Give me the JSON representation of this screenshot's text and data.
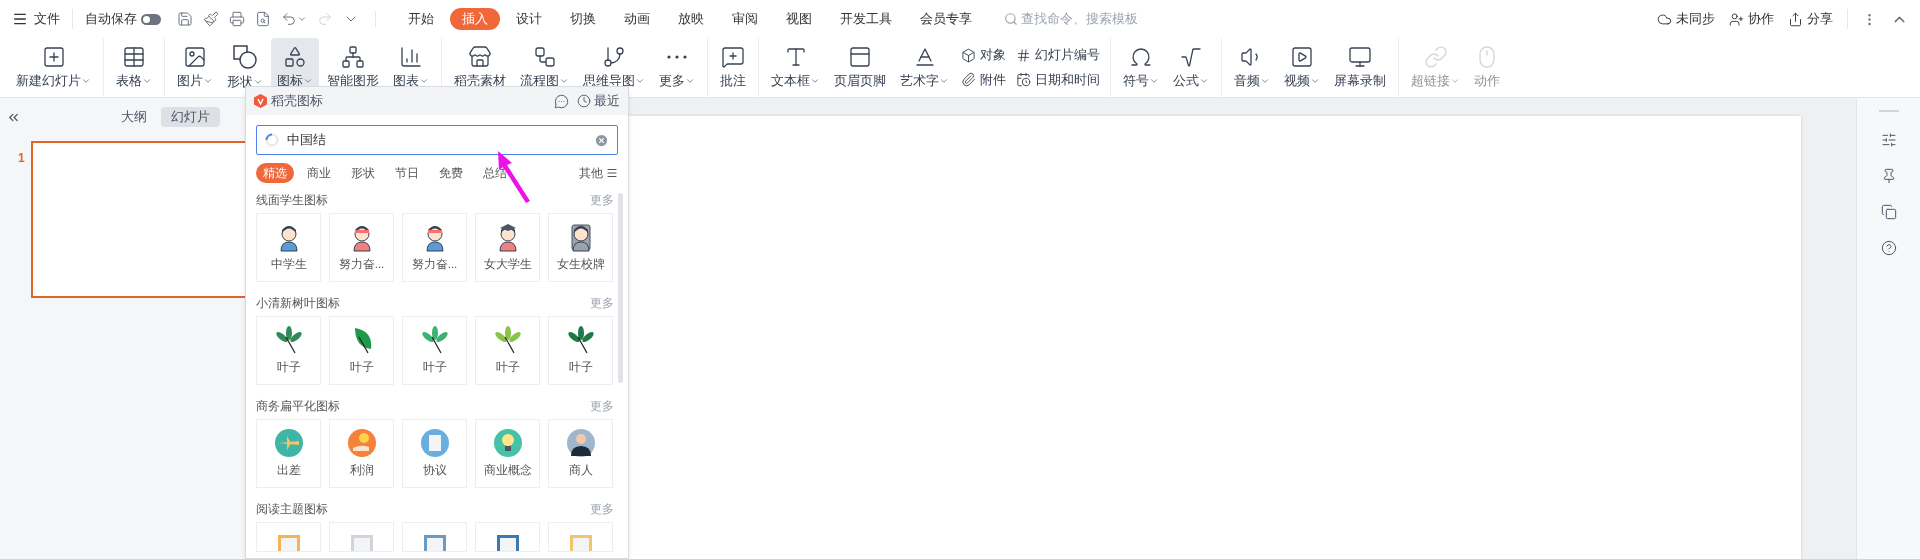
{
  "menu_bar": {
    "file_menu": "文件",
    "autosave": {
      "label": "自动保存",
      "on": false
    },
    "tabs": [
      {
        "label": "开始",
        "selected": false
      },
      {
        "label": "插入",
        "selected": true
      },
      {
        "label": "设计",
        "selected": false
      },
      {
        "label": "切换",
        "selected": false
      },
      {
        "label": "动画",
        "selected": false
      },
      {
        "label": "放映",
        "selected": false
      },
      {
        "label": "审阅",
        "selected": false
      },
      {
        "label": "视图",
        "selected": false
      },
      {
        "label": "开发工具",
        "selected": false
      },
      {
        "label": "会员专享",
        "selected": false
      }
    ],
    "search": {
      "placeholder": "查找命令、搜索模板"
    },
    "actions": [
      "未同步",
      "协作",
      "分享"
    ]
  },
  "ribbon": {
    "groups": [
      [
        {
          "kind": "large",
          "label": "新建幻灯片",
          "dropdown": true,
          "open": false,
          "disabled": false
        }
      ],
      [
        {
          "kind": "large",
          "label": "表格",
          "dropdown": true,
          "open": false,
          "disabled": false
        }
      ],
      [
        {
          "kind": "large",
          "label": "图片",
          "dropdown": true,
          "open": false,
          "disabled": false
        },
        {
          "kind": "large",
          "label": "形状",
          "dropdown": true,
          "open": false,
          "disabled": false
        },
        {
          "kind": "large",
          "label": "图标",
          "dropdown": true,
          "open": true,
          "disabled": false
        },
        {
          "kind": "large",
          "label": "智能图形",
          "dropdown": false,
          "open": false,
          "disabled": false
        },
        {
          "kind": "large",
          "label": "图表",
          "dropdown": true,
          "open": false,
          "disabled": false
        }
      ],
      [
        {
          "kind": "large",
          "label": "稻壳素材",
          "dropdown": false,
          "open": false,
          "disabled": false
        },
        {
          "kind": "large",
          "label": "流程图",
          "dropdown": true,
          "open": false,
          "disabled": false
        },
        {
          "kind": "large",
          "label": "思维导图",
          "dropdown": true,
          "open": false,
          "disabled": false
        },
        {
          "kind": "large",
          "label": "更多",
          "dropdown": true,
          "open": false,
          "disabled": false
        }
      ],
      [
        {
          "kind": "large",
          "label": "批注",
          "dropdown": false,
          "open": false,
          "disabled": false
        }
      ],
      [
        {
          "kind": "large",
          "label": "文本框",
          "dropdown": true,
          "open": false,
          "disabled": false
        },
        {
          "kind": "large",
          "label": "页眉页脚",
          "dropdown": false,
          "open": false,
          "disabled": false
        },
        {
          "kind": "large",
          "label": "艺术字",
          "dropdown": true,
          "open": false,
          "disabled": false
        },
        {
          "kind": "stack",
          "items": [
            "对象",
            "附件"
          ]
        },
        {
          "kind": "stack",
          "items": [
            "幻灯片编号",
            "日期和时间"
          ]
        }
      ],
      [
        {
          "kind": "large",
          "label": "符号",
          "dropdown": true,
          "open": false,
          "disabled": false
        },
        {
          "kind": "large",
          "label": "公式",
          "dropdown": true,
          "open": false,
          "disabled": false
        }
      ],
      [
        {
          "kind": "large",
          "label": "音频",
          "dropdown": true,
          "open": false,
          "disabled": false
        },
        {
          "kind": "large",
          "label": "视频",
          "dropdown": true,
          "open": false,
          "disabled": false
        },
        {
          "kind": "large",
          "label": "屏幕录制",
          "dropdown": false,
          "open": false,
          "disabled": false
        }
      ],
      [
        {
          "kind": "large",
          "label": "超链接",
          "dropdown": true,
          "open": false,
          "disabled": true
        },
        {
          "kind": "large",
          "label": "动作",
          "dropdown": false,
          "open": false,
          "disabled": true
        }
      ]
    ]
  },
  "side_panel": {
    "tabs": [
      {
        "label": "大纲",
        "selected": false
      },
      {
        "label": "幻灯片",
        "selected": true
      }
    ],
    "slides": [
      {
        "number": "1",
        "selected": true
      }
    ]
  },
  "icon_panel": {
    "title": "稻壳图标",
    "recent": "最近",
    "search": {
      "value": "中国结"
    },
    "categories": [
      {
        "label": "精选",
        "selected": true
      },
      {
        "label": "商业",
        "selected": false
      },
      {
        "label": "形状",
        "selected": false
      },
      {
        "label": "节日",
        "selected": false
      },
      {
        "label": "免费",
        "selected": false
      },
      {
        "label": "总结",
        "selected": false
      }
    ],
    "other": "其他",
    "sections": [
      {
        "title": "线面学生图标",
        "more": "更多",
        "kind": "student",
        "items": [
          {
            "label": "中学生"
          },
          {
            "label": "努力奋..."
          },
          {
            "label": "努力奋..."
          },
          {
            "label": "女大学生"
          },
          {
            "label": "女生校牌"
          }
        ]
      },
      {
        "title": "小清新树叶图标",
        "more": "更多",
        "kind": "leaf",
        "items": [
          {
            "label": "叶子"
          },
          {
            "label": "叶子"
          },
          {
            "label": "叶子"
          },
          {
            "label": "叶子"
          },
          {
            "label": "叶子"
          }
        ]
      },
      {
        "title": "商务扁平化图标",
        "more": "更多",
        "kind": "business",
        "items": [
          {
            "label": "出差"
          },
          {
            "label": "利润"
          },
          {
            "label": "协议"
          },
          {
            "label": "商业概念"
          },
          {
            "label": "商人"
          }
        ]
      },
      {
        "title": "阅读主题图标",
        "more": "更多",
        "kind": "book",
        "items": [
          {
            "cut_off": true
          },
          {
            "cut_off": true
          },
          {
            "cut_off": true
          },
          {
            "cut_off": true
          },
          {
            "cut_off": true
          }
        ]
      }
    ]
  }
}
